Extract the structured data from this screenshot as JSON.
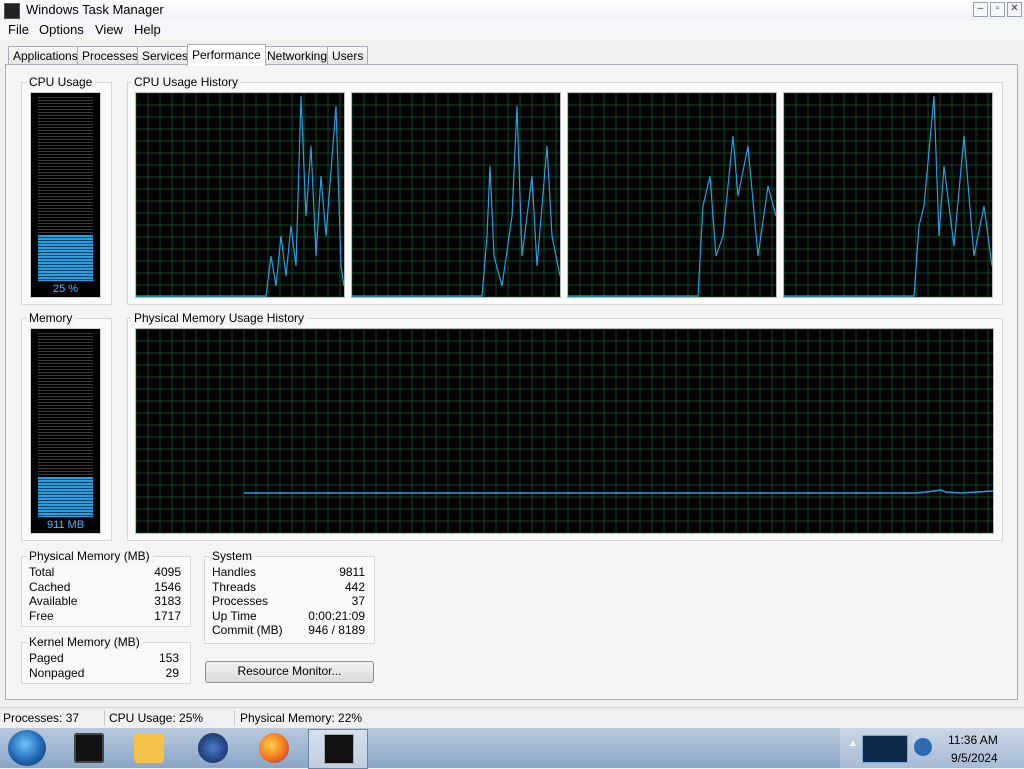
{
  "window": {
    "title": "Windows Task Manager"
  },
  "menu": [
    "File",
    "Options",
    "View",
    "Help"
  ],
  "tabs": [
    "Applications",
    "Processes",
    "Services",
    "Performance",
    "Networking",
    "Users"
  ],
  "active_tab": "Performance",
  "cpu_usage": {
    "label": "CPU Usage",
    "meter_text": "25 %",
    "level": 0.25
  },
  "cpu_history": {
    "label": "CPU Usage History"
  },
  "memory": {
    "label": "Memory",
    "meter_text": "911 MB",
    "level": 0.22
  },
  "memory_history": {
    "label": "Physical Memory Usage History"
  },
  "physical_memory": {
    "label": "Physical Memory (MB)",
    "rows": [
      {
        "name": "Total",
        "value": "4095"
      },
      {
        "name": "Cached",
        "value": "1546"
      },
      {
        "name": "Available",
        "value": "3183"
      },
      {
        "name": "Free",
        "value": "1717"
      }
    ]
  },
  "kernel_memory": {
    "label": "Kernel Memory (MB)",
    "rows": [
      {
        "name": "Paged",
        "value": "153"
      },
      {
        "name": "Nonpaged",
        "value": "29"
      }
    ]
  },
  "system": {
    "label": "System",
    "rows": [
      {
        "name": "Handles",
        "value": "9811"
      },
      {
        "name": "Threads",
        "value": "442"
      },
      {
        "name": "Processes",
        "value": "37"
      },
      {
        "name": "Up Time",
        "value": "0:00:21:09"
      },
      {
        "name": "Commit (MB)",
        "value": "946 / 8189"
      }
    ]
  },
  "resource_monitor_button": "Resource Monitor...",
  "status": {
    "processes": "Processes: 37",
    "cpu": "CPU Usage: 25%",
    "memory": "Physical Memory: 22%"
  },
  "taskbar": {
    "icons": [
      "start-orb-icon",
      "terminal-icon",
      "media-player-icon",
      "globe-icon",
      "firefox-icon",
      "task-manager-icon"
    ],
    "clock_time": "11:36 AM",
    "clock_date": "9/5/2024"
  },
  "colors": {
    "graph_line": "#2a9fe0",
    "graph_grid": "#0f4a24",
    "meter_text": "#4eb3ff"
  }
}
